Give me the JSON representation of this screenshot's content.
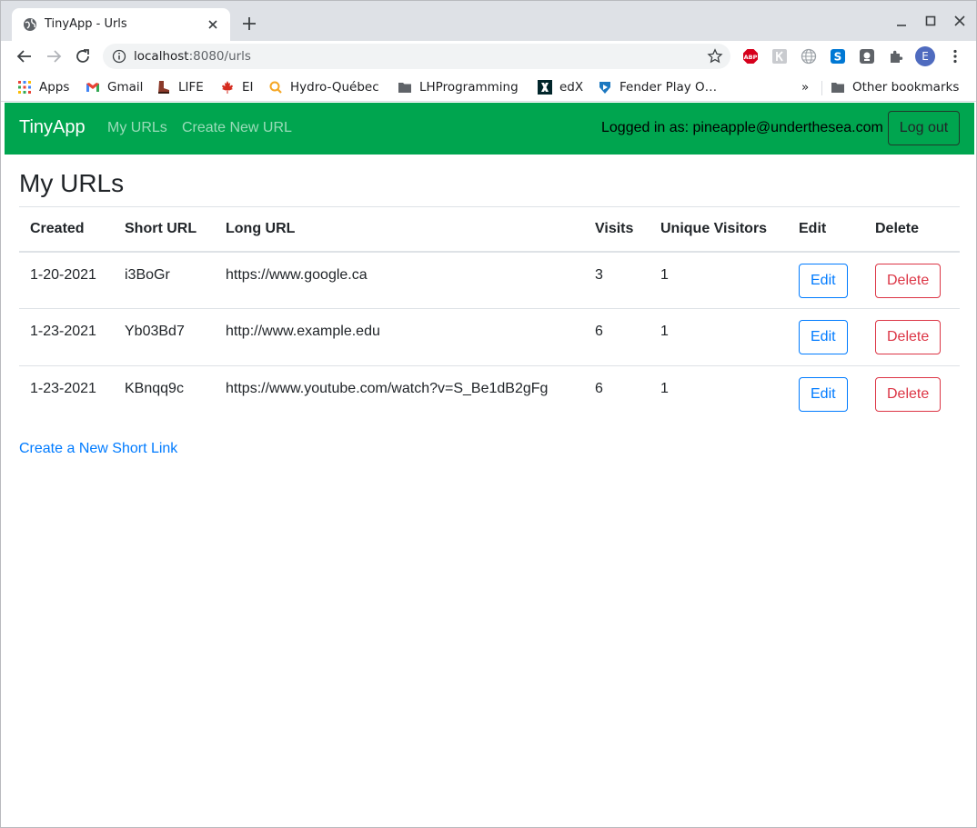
{
  "browser": {
    "tab_title": "TinyApp - Urls",
    "url_host": "localhost",
    "url_rest": ":8080/urls",
    "profile_initial": "E",
    "bookmarks": [
      {
        "label": "Apps",
        "icon": "apps-grid-icon"
      },
      {
        "label": "Gmail",
        "icon": "gmail-icon"
      },
      {
        "label": "LIFE",
        "icon": "boot-icon"
      },
      {
        "label": "EI",
        "icon": "maple-leaf-icon"
      },
      {
        "label": "Hydro-Québec",
        "icon": "hydro-quebec-icon"
      },
      {
        "label": "LHProgramming",
        "icon": "folder-icon"
      },
      {
        "label": "edX",
        "icon": "edx-icon"
      },
      {
        "label": "Fender Play O…",
        "icon": "fender-icon"
      }
    ],
    "overflow": "»",
    "other_bookmarks": "Other bookmarks"
  },
  "navbar": {
    "brand": "TinyApp",
    "links": [
      "My URLs",
      "Create New URL"
    ],
    "logged_in_text": "Logged in as: pineapple@underthesea.com",
    "logout_label": "Log out",
    "bg_color": "#00a54f"
  },
  "main": {
    "heading": "My URLs",
    "columns": [
      "Created",
      "Short URL",
      "Long URL",
      "Visits",
      "Unique Visitors",
      "Edit",
      "Delete"
    ],
    "rows": [
      {
        "created": "1-20-2021",
        "short": "i3BoGr",
        "long": "https://www.google.ca",
        "visits": "3",
        "unique": "1",
        "edit": "Edit",
        "delete": "Delete"
      },
      {
        "created": "1-23-2021",
        "short": "Yb03Bd7",
        "long": "http://www.example.edu",
        "visits": "6",
        "unique": "1",
        "edit": "Edit",
        "delete": "Delete"
      },
      {
        "created": "1-23-2021",
        "short": "KBnqq9c",
        "long": "https://www.youtube.com/watch?v=S_Be1dB2gFg",
        "visits": "6",
        "unique": "1",
        "edit": "Edit",
        "delete": "Delete"
      }
    ],
    "create_link": "Create a New Short Link"
  }
}
